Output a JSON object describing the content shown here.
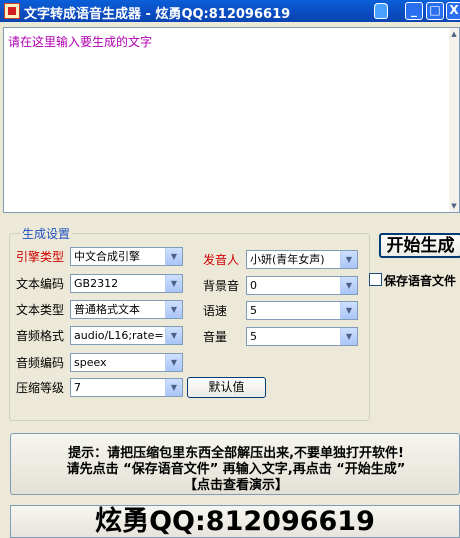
{
  "window": {
    "title": "文字转成语音生成器 - 炫勇QQ:812096619",
    "minimize": "_",
    "maximize": "□",
    "close": "X"
  },
  "editor": {
    "placeholder": "请在这里输入要生成的文字"
  },
  "settings": {
    "group_title": "生成设置",
    "engine_label": "引擎类型",
    "engine_value": "中文合成引擎",
    "speaker_label": "发音人",
    "speaker_value": "小妍(青年女声)",
    "encoding_label": "文本编码",
    "encoding_value": "GB2312",
    "bgm_label": "背景音",
    "bgm_value": "0",
    "texttype_label": "文本类型",
    "texttype_value": "普通格式文本",
    "speed_label": "语速",
    "speed_value": "5",
    "audioformat_label": "音频格式",
    "audioformat_value": "audio/L16;rate=",
    "volume_label": "音量",
    "volume_value": "5",
    "audiocodec_label": "音频编码",
    "audiocodec_value": "speex",
    "compress_label": "压缩等级",
    "compress_value": "7",
    "default_button": "默认值"
  },
  "actions": {
    "start_button": "开始生成",
    "save_checkbox_label": "保存语音文件",
    "save_checked": false
  },
  "notice": {
    "line1": "提示：请把压缩包里东西全部解压出来,不要单独打开软件!",
    "line2": "请先点击 “保存语音文件” 再输入文字,再点击 “开始生成”",
    "line3": "【点击查看演示】"
  },
  "footer": {
    "qq": "炫勇QQ:812096619"
  },
  "colors": {
    "accent_red": "#d00000",
    "group_title": "#2050c0",
    "placeholder": "#b000b0",
    "titlebar": "#0b4cc0"
  }
}
